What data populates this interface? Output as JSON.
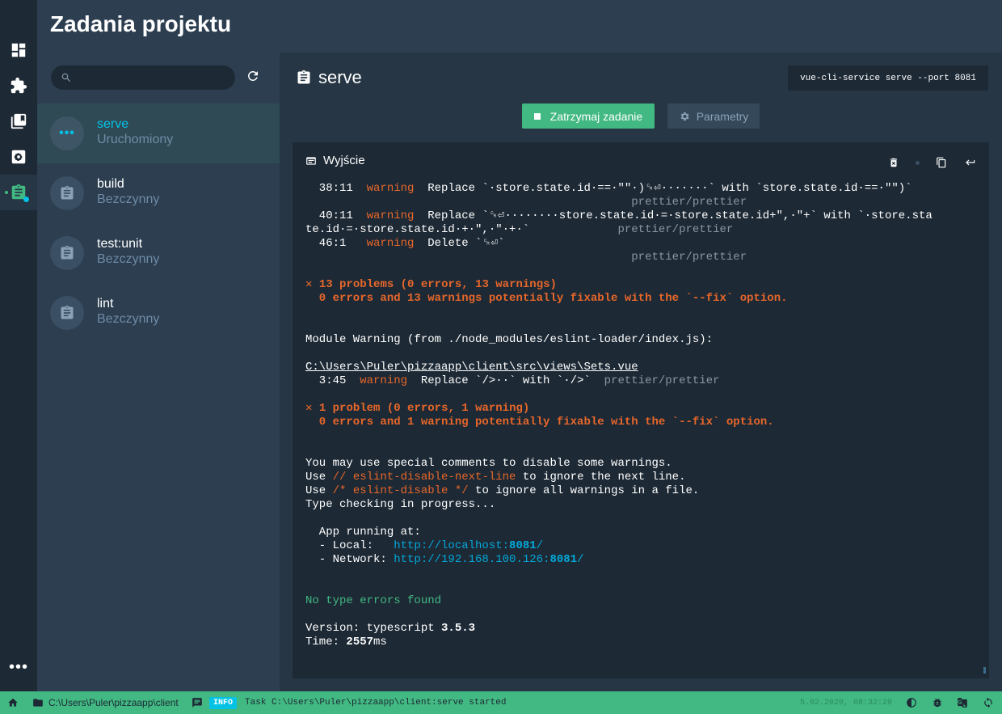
{
  "page_title": "Zadania projektu",
  "search": {
    "placeholder": "",
    "value": ""
  },
  "tasks": [
    {
      "name": "serve",
      "status": "Uruchomiony",
      "running": true
    },
    {
      "name": "build",
      "status": "Bezczynny"
    },
    {
      "name": "test:unit",
      "status": "Bezczynny"
    },
    {
      "name": "lint",
      "status": "Bezczynny"
    }
  ],
  "detail": {
    "title": "serve",
    "command": "vue-cli-service serve --port 8081",
    "stop_label": "Zatrzymaj zadanie",
    "params_label": "Parametry",
    "output_label": "Wyjście"
  },
  "terminal_lines": [
    [
      {
        "t": "  38:11  "
      },
      {
        "t": "warning",
        "c": "w"
      },
      {
        "t": "  Replace `·store.state.id·==·\"\"·)␍⏎·······` with `store.state.id·==·\"\")`"
      }
    ],
    [
      {
        "t": "                                                "
      },
      {
        "t": "prettier/prettier",
        "c": "g"
      }
    ],
    [
      {
        "t": "  40:11  "
      },
      {
        "t": "warning",
        "c": "w"
      },
      {
        "t": "  Replace `␍⏎········store.state.id·=·store.state.id+\",·\"+` with `·store.sta"
      }
    ],
    [
      {
        "t": "te.id·=·store.state.id·+·\",·\"·+·`             "
      },
      {
        "t": "prettier/prettier",
        "c": "g"
      }
    ],
    [
      {
        "t": "  46:1   "
      },
      {
        "t": "warning",
        "c": "w"
      },
      {
        "t": "  Delete `␍⏎`"
      }
    ],
    [
      {
        "t": "                                                "
      },
      {
        "t": "prettier/prettier",
        "c": "g"
      }
    ],
    [
      {
        "t": ""
      }
    ],
    [
      {
        "t": "✕ ",
        "c": "o b"
      },
      {
        "t": "13 problems (0 errors, 13 warnings)",
        "c": "o b"
      }
    ],
    [
      {
        "t": "  0 errors and 13 warnings potentially fixable with the `--fix` option.",
        "c": "o b"
      }
    ],
    [
      {
        "t": ""
      }
    ],
    [
      {
        "t": ""
      }
    ],
    [
      {
        "t": "Module Warning (from ./node_modules/eslint-loader/index.js):"
      }
    ],
    [
      {
        "t": ""
      }
    ],
    [
      {
        "t": "C:\\Users\\Puler\\pizzaapp\\client\\src\\views\\Sets.vue",
        "c": "u"
      }
    ],
    [
      {
        "t": "  3:45  "
      },
      {
        "t": "warning",
        "c": "w"
      },
      {
        "t": "  Replace `/>··` with `·/>`  "
      },
      {
        "t": "prettier/prettier",
        "c": "g"
      }
    ],
    [
      {
        "t": ""
      }
    ],
    [
      {
        "t": "✕ ",
        "c": "o b"
      },
      {
        "t": "1 problem (0 errors, 1 warning)",
        "c": "o b"
      }
    ],
    [
      {
        "t": "  0 errors and 1 warning potentially fixable with the `--fix` option.",
        "c": "o b"
      }
    ],
    [
      {
        "t": ""
      }
    ],
    [
      {
        "t": ""
      }
    ],
    [
      {
        "t": "You may use special comments to disable some warnings."
      }
    ],
    [
      {
        "t": "Use "
      },
      {
        "t": "// eslint-disable-next-line",
        "c": "w"
      },
      {
        "t": " to ignore the next line."
      }
    ],
    [
      {
        "t": "Use "
      },
      {
        "t": "/* eslint-disable */",
        "c": "w"
      },
      {
        "t": " to ignore all warnings in a file."
      }
    ],
    [
      {
        "t": "Type checking in progress..."
      }
    ],
    [
      {
        "t": ""
      }
    ],
    [
      {
        "t": "  App running at:"
      }
    ],
    [
      {
        "t": "  - Local:   "
      },
      {
        "t": "http://localhost:",
        "c": "lnk"
      },
      {
        "t": "8081",
        "c": "lnkb"
      },
      {
        "t": "/",
        "c": "lnk"
      }
    ],
    [
      {
        "t": "  - Network: "
      },
      {
        "t": "http://192.168.100.126:",
        "c": "lnk"
      },
      {
        "t": "8081",
        "c": "lnkb"
      },
      {
        "t": "/",
        "c": "lnk"
      }
    ],
    [
      {
        "t": ""
      }
    ],
    [
      {
        "t": ""
      }
    ],
    [
      {
        "t": "No type errors found",
        "c": "ok"
      }
    ],
    [
      {
        "t": ""
      }
    ],
    [
      {
        "t": "Version: typescript "
      },
      {
        "t": "3.5.3",
        "c": "b"
      }
    ],
    [
      {
        "t": "Time: "
      },
      {
        "t": "2557",
        "c": "b"
      },
      {
        "t": "ms"
      }
    ]
  ],
  "statusbar": {
    "path": "C:\\Users\\Puler\\pizzaapp\\client",
    "log_level": "INFO",
    "log_message": "Task C:\\Users\\Puler\\pizzaapp\\client:serve started",
    "timestamp": "5.02.2020, 08:32:29"
  },
  "icons": {
    "rail": [
      "dashboard-icon",
      "plugins-icon",
      "dependencies-icon",
      "configuration-icon",
      "tasks-icon",
      "more-icon"
    ]
  },
  "colors": {
    "accent": "#42b983",
    "running": "#03c2e6",
    "warning": "#e8672a"
  }
}
